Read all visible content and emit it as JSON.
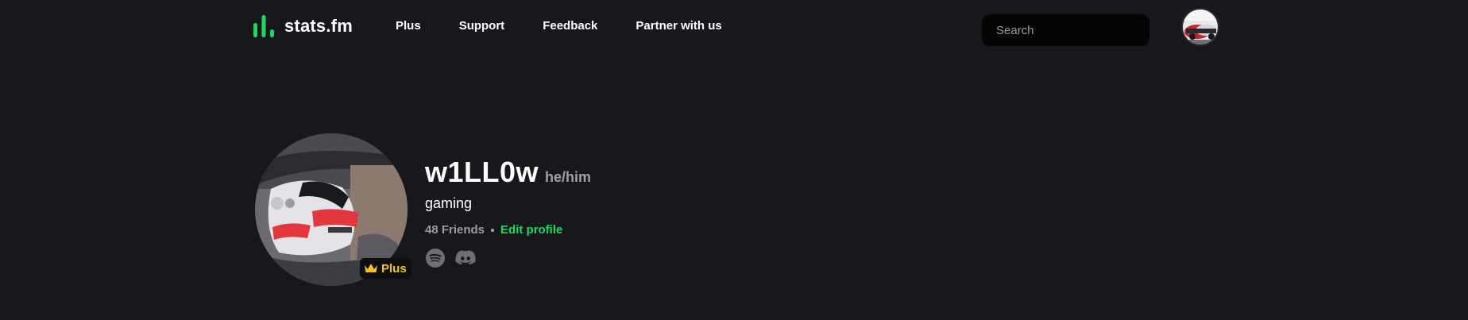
{
  "header": {
    "logo_text": "stats.fm",
    "nav": [
      "Plus",
      "Support",
      "Feedback",
      "Partner with us"
    ],
    "search_placeholder": "Search"
  },
  "profile": {
    "username": "w1LL0w",
    "pronouns": "he/him",
    "bio": "gaming",
    "friends": "48 Friends",
    "edit_label": "Edit profile",
    "plus_badge": "Plus"
  },
  "colors": {
    "background": "#18181c",
    "accent": "#1ed760",
    "plus_gold": "#f5c518",
    "muted_text": "#9a9aa2"
  },
  "icons": [
    "stats-logo-icon",
    "search-icon",
    "crown-icon",
    "spotify-icon",
    "discord-icon"
  ]
}
